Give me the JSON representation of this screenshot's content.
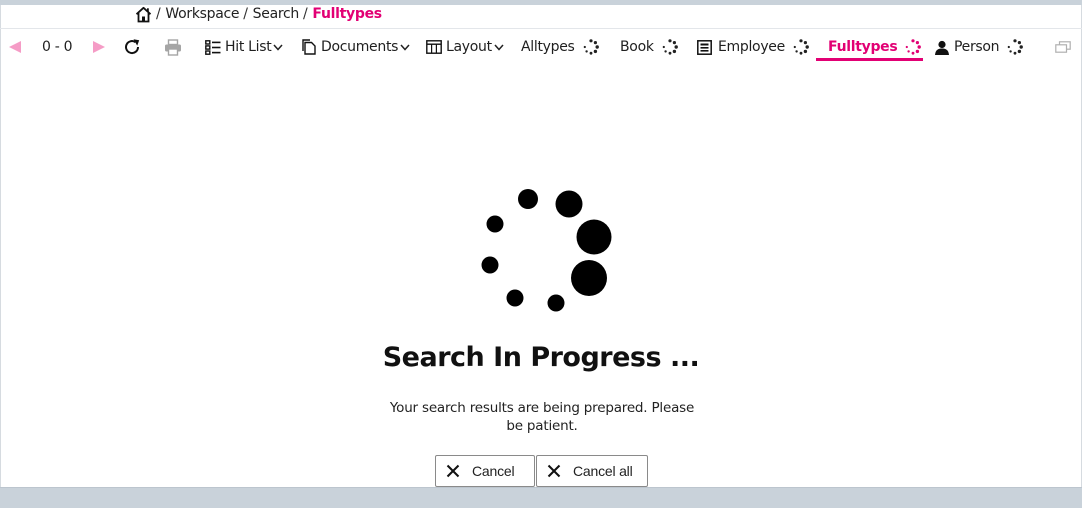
{
  "breadcrumb": {
    "home_icon": "home-icon",
    "items": [
      "Workspace",
      "Search",
      "Fulltypes"
    ],
    "separator": "/"
  },
  "toolbar": {
    "prev_icon": "triangle-left-icon",
    "page_range": "0 - 0",
    "next_icon": "triangle-right-icon",
    "refresh_icon": "refresh-icon",
    "print_icon": "print-icon",
    "hitlist_label": "Hit List",
    "documents_label": "Documents",
    "layout_label": "Layout",
    "window_icon": "restore-window-icon"
  },
  "tabs": [
    {
      "label": "Alltypes",
      "icon": "",
      "status": "loading"
    },
    {
      "label": "Book",
      "icon": "",
      "status": "loading"
    },
    {
      "label": "Employee",
      "icon": "contact-card-icon",
      "status": "loading"
    },
    {
      "label": "Fulltypes",
      "icon": "",
      "status": "loading",
      "active": true
    },
    {
      "label": "Person",
      "icon": "person-icon",
      "status": "loading"
    }
  ],
  "progress": {
    "title": "Search In Progress ...",
    "message": "Your search results are being prepared. Please be patient.",
    "cancel_label": "Cancel",
    "cancel_all_label": "Cancel all"
  },
  "colors": {
    "accent": "#e20074",
    "accent_light": "#f59cc6",
    "frame": "#c9d2da",
    "text": "#1a1a1a"
  }
}
